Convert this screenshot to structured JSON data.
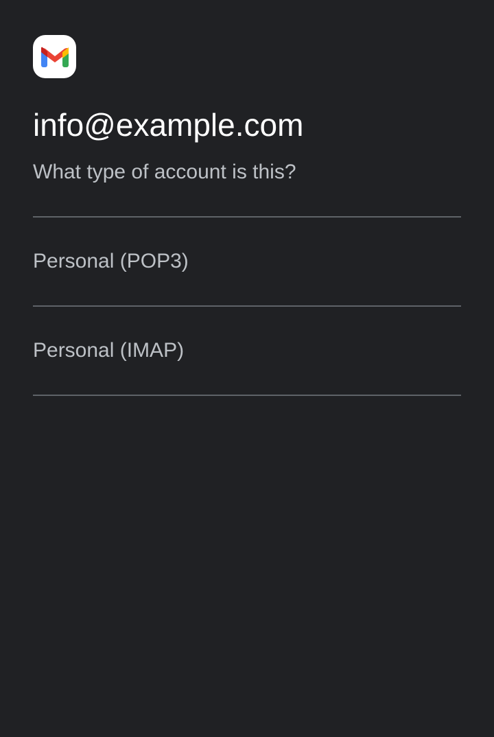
{
  "app": {
    "icon": "gmail-logo-icon",
    "brand_colors": {
      "blue": "#4285F4",
      "red": "#EA4335",
      "yellow": "#FBBC04",
      "green": "#34A853"
    }
  },
  "header": {
    "email": "info@example.com",
    "question": "What type of account is this?"
  },
  "account_types": [
    {
      "label": "Personal (POP3)"
    },
    {
      "label": "Personal (IMAP)"
    }
  ],
  "theme": {
    "background": "#202124",
    "divider": "#5f6368",
    "primary_text": "#ffffff",
    "secondary_text": "#bdc1c6"
  }
}
